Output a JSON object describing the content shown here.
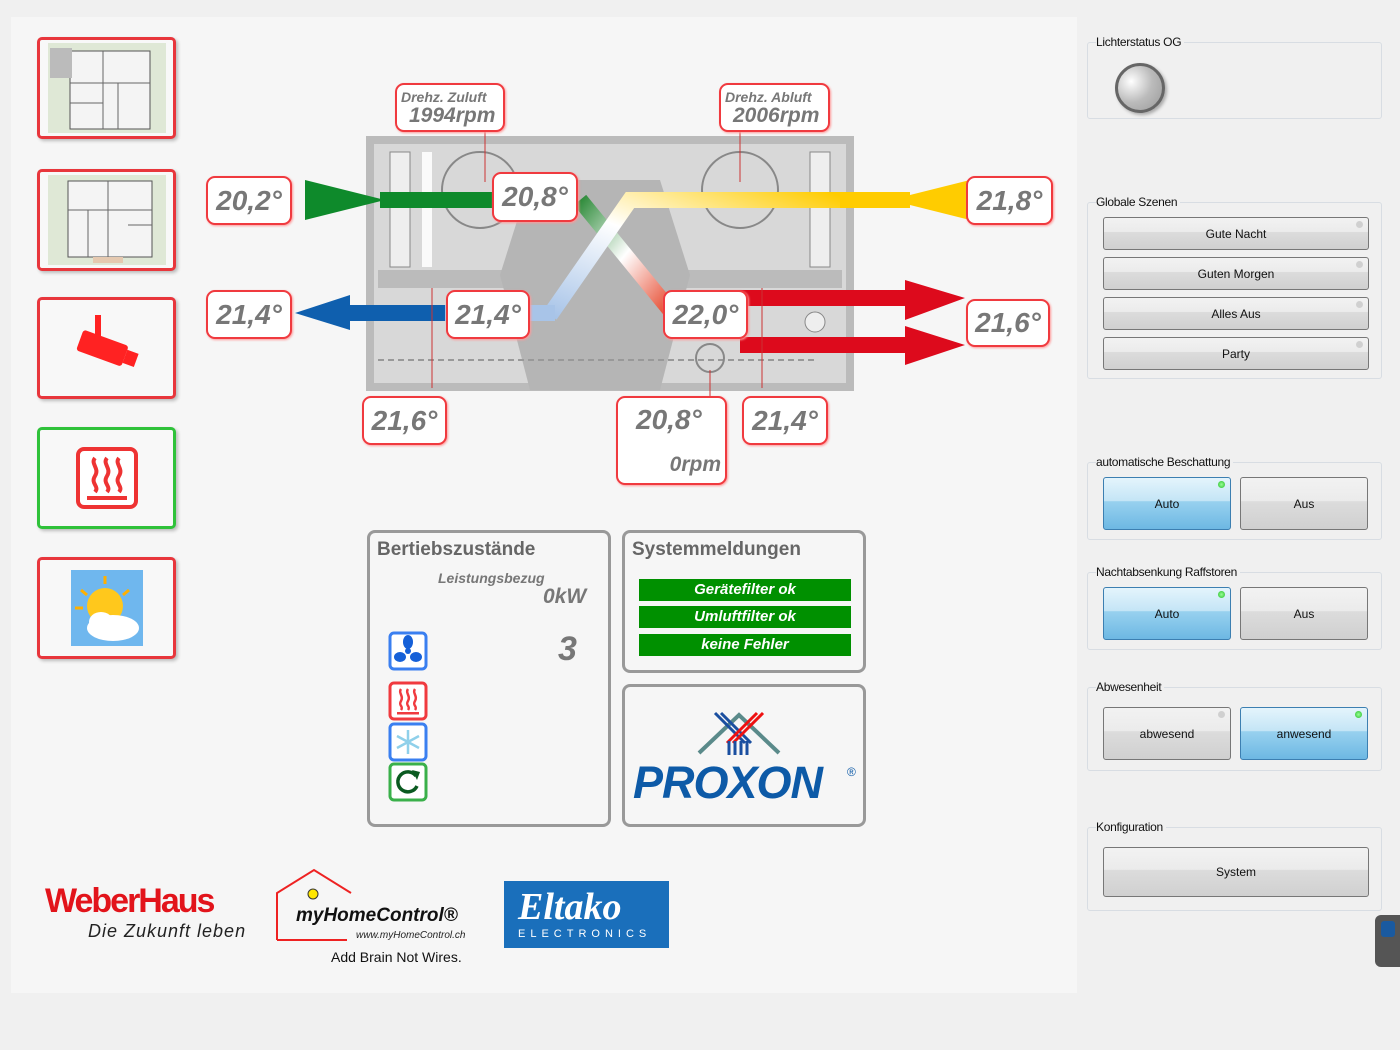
{
  "nav": [
    {
      "icon": "floorplan-og-icon"
    },
    {
      "icon": "floorplan-eg-icon"
    },
    {
      "icon": "camera-icon"
    },
    {
      "icon": "heating-icon",
      "active": true
    },
    {
      "icon": "weather-icon"
    }
  ],
  "ventilation": {
    "supply_fan_label": "Drehz. Zuluft",
    "supply_fan_rpm": "1994rpm",
    "exhaust_fan_label": "Drehz. Abluft",
    "exhaust_fan_rpm": "2006rpm",
    "outdoor_in": "20,2°",
    "supply_after_filter": "20,8°",
    "extract_in": "21,8°",
    "exhaust_out": "21,4°",
    "exhaust_mid": "21,4°",
    "supply_mid": "22,0°",
    "supply_out": "21,6°",
    "bottom_left": "21,6°",
    "bypass_temp": "20,8°",
    "bypass_rpm": "0rpm",
    "bottom_right": "21,4°"
  },
  "status": {
    "title": "Bertiebszustände",
    "power_label": "Leistungsbezug",
    "power_value": "0kW",
    "fan_level": "3",
    "icons": [
      "fan-icon",
      "heating-icon",
      "cooling-icon",
      "recirculation-icon"
    ]
  },
  "messages": {
    "title": "Systemmeldungen",
    "items": [
      "Gerätefilter ok",
      "Umluftfilter ok",
      "keine Fehler"
    ],
    "color": "#009000"
  },
  "logos": {
    "proxon": "PROXON",
    "weberhaus": "WeberHaus",
    "weberhaus_tagline": "Die Zukunft leben",
    "myhomecontrol": "myHomeControl®",
    "myhomecontrol_url": "www.myHomeControl.ch",
    "myhomecontrol_slogan": "Add Brain Not Wires.",
    "eltako": "Eltako",
    "eltako_sub": "ELECTRONICS"
  },
  "right": {
    "light": {
      "label": "Lichterstatus OG",
      "state": "off"
    },
    "scenes": {
      "label": "Globale Szenen",
      "buttons": [
        "Gute Nacht",
        "Guten Morgen",
        "Alles Aus",
        "Party"
      ]
    },
    "shading": {
      "label": "automatische Beschattung",
      "auto": "Auto",
      "off": "Aus",
      "active": "Auto"
    },
    "night": {
      "label": "Nachtabsenkung Raffstoren",
      "auto": "Auto",
      "off": "Aus",
      "active": "Auto"
    },
    "absence": {
      "label": "Abwesenheit",
      "away": "abwesend",
      "present": "anwesend",
      "active": "anwesend"
    },
    "config": {
      "label": "Konfiguration",
      "system": "System"
    }
  }
}
